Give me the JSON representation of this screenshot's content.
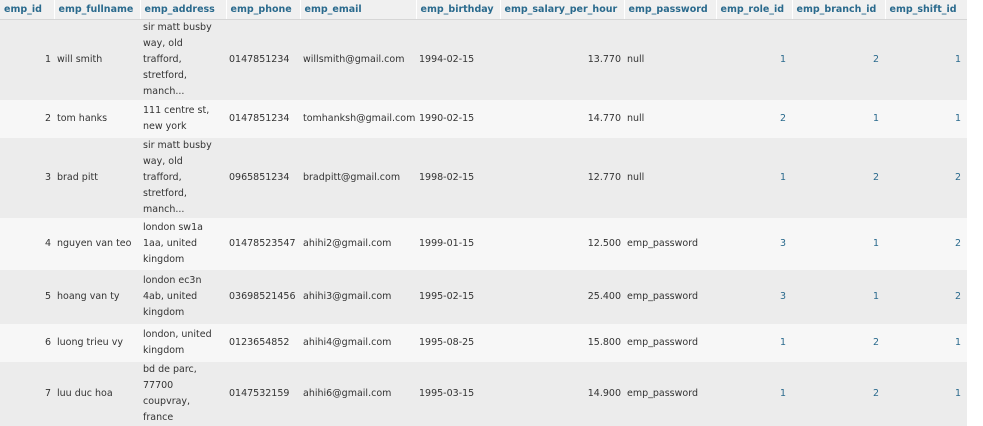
{
  "columns": [
    "emp_id",
    "emp_fullname",
    "emp_address",
    "emp_phone",
    "emp_email",
    "emp_birthday",
    "emp_salary_per_hour",
    "emp_password",
    "emp_role_id",
    "emp_branch_id",
    "emp_shift_id"
  ],
  "rows": [
    {
      "emp_id": "1",
      "emp_fullname": "will smith",
      "emp_address": [
        "sir matt busby",
        "way, old trafford,",
        "stretford,",
        "manch..."
      ],
      "emp_phone": "0147851234",
      "emp_email": "willsmith@gmail.com",
      "emp_birthday": "1994-02-15",
      "emp_salary_per_hour": "13.770",
      "emp_password": "null",
      "emp_role_id": "1",
      "emp_branch_id": "2",
      "emp_shift_id": "1"
    },
    {
      "emp_id": "2",
      "emp_fullname": "tom hanks",
      "emp_address": [
        "111 centre st,",
        "new york"
      ],
      "emp_phone": "0147851234",
      "emp_email": "tomhanksh@gmail.com",
      "emp_birthday": "1990-02-15",
      "emp_salary_per_hour": "14.770",
      "emp_password": "null",
      "emp_role_id": "2",
      "emp_branch_id": "1",
      "emp_shift_id": "1"
    },
    {
      "emp_id": "3",
      "emp_fullname": "brad pitt",
      "emp_address": [
        "sir matt busby",
        "way, old trafford,",
        "stretford,",
        "manch..."
      ],
      "emp_phone": "0965851234",
      "emp_email": "bradpitt@gmail.com",
      "emp_birthday": "1998-02-15",
      "emp_salary_per_hour": "12.770",
      "emp_password": "null",
      "emp_role_id": "1",
      "emp_branch_id": "2",
      "emp_shift_id": "2"
    },
    {
      "emp_id": "4",
      "emp_fullname": "nguyen van teo",
      "emp_address": [
        "london sw1a",
        "1aa, united",
        "kingdom"
      ],
      "emp_phone": "01478523547",
      "emp_email": "ahihi2@gmail.com",
      "emp_birthday": "1999-01-15",
      "emp_salary_per_hour": "12.500",
      "emp_password": "emp_password",
      "emp_role_id": "3",
      "emp_branch_id": "1",
      "emp_shift_id": "2"
    },
    {
      "emp_id": "5",
      "emp_fullname": "hoang van ty",
      "emp_address": [
        "london ec3n",
        "4ab, united",
        "kingdom"
      ],
      "emp_phone": "03698521456",
      "emp_email": "ahihi3@gmail.com",
      "emp_birthday": "1995-02-15",
      "emp_salary_per_hour": "25.400",
      "emp_password": "emp_password",
      "emp_role_id": "3",
      "emp_branch_id": "1",
      "emp_shift_id": "2"
    },
    {
      "emp_id": "6",
      "emp_fullname": "luong trieu vy",
      "emp_address": [
        " london, united",
        "kingdom"
      ],
      "emp_phone": "0123654852",
      "emp_email": "ahihi4@gmail.com",
      "emp_birthday": "1995-08-25",
      "emp_salary_per_hour": "15.800",
      "emp_password": "emp_password",
      "emp_role_id": "1",
      "emp_branch_id": "2",
      "emp_shift_id": "1"
    },
    {
      "emp_id": "7",
      "emp_fullname": "luu duc hoa",
      "emp_address": [
        "bd de parc,",
        "77700 coupvray,",
        "france"
      ],
      "emp_phone": "0147532159",
      "emp_email": "ahihi6@gmail.com",
      "emp_birthday": "1995-03-15",
      "emp_salary_per_hour": "14.900",
      "emp_password": "emp_password",
      "emp_role_id": "1",
      "emp_branch_id": "2",
      "emp_shift_id": "1"
    }
  ]
}
